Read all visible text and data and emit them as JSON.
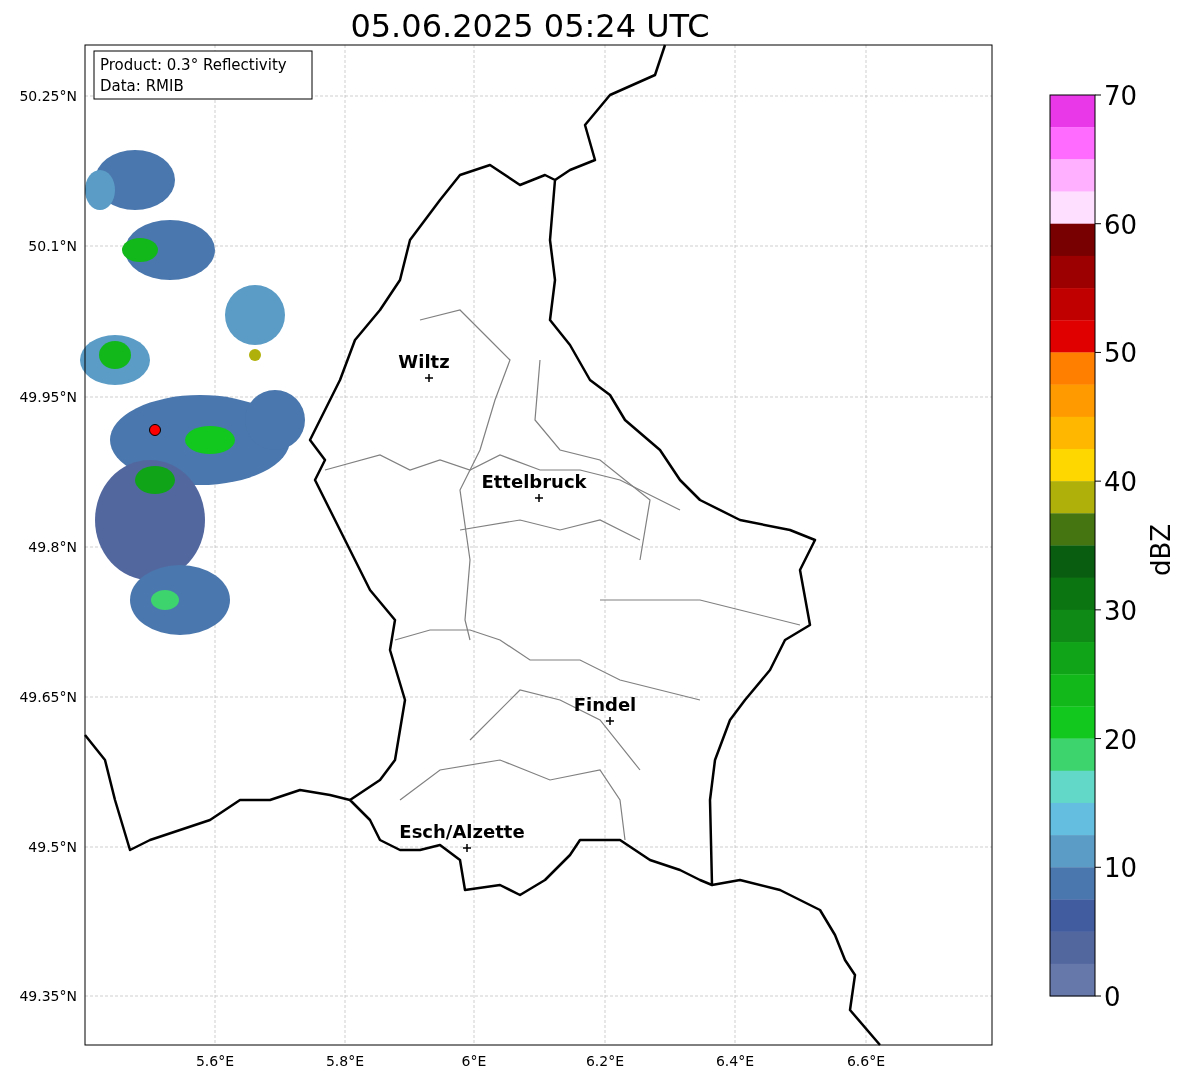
{
  "title": "05.06.2025 05:24 UTC",
  "info_box": [
    "Product: 0.3° Reflectivity",
    "Data: RMIB"
  ],
  "map": {
    "cities": [
      {
        "name": "Wiltz"
      },
      {
        "name": "Ettelbruck"
      },
      {
        "name": "Findel"
      },
      {
        "name": "Esch/Alzette"
      }
    ],
    "x_ticks": [
      "5.6°E",
      "5.8°E",
      "6°E",
      "6.2°E",
      "6.4°E",
      "6.6°E"
    ],
    "y_ticks": [
      "50.25°N",
      "50.1°N",
      "49.95°N",
      "49.8°N",
      "49.65°N",
      "49.5°N",
      "49.35°N"
    ]
  },
  "colorbar": {
    "label": "dBZ",
    "ticks": [
      "70",
      "60",
      "50",
      "40",
      "30",
      "20",
      "10",
      "0"
    ],
    "bins": [
      {
        "color": "#e838e8"
      },
      {
        "color": "#ff6aff"
      },
      {
        "color": "#ffb0ff"
      },
      {
        "color": "#ffdfff"
      },
      {
        "color": "#780000"
      },
      {
        "color": "#9c0000"
      },
      {
        "color": "#c00000"
      },
      {
        "color": "#e00000"
      },
      {
        "color": "#ff7f00"
      },
      {
        "color": "#ff9a00"
      },
      {
        "color": "#ffb700"
      },
      {
        "color": "#ffd700"
      },
      {
        "color": "#b0b00a"
      },
      {
        "color": "#447510"
      },
      {
        "color": "#095d10"
      },
      {
        "color": "#0b7512"
      },
      {
        "color": "#0f8a16"
      },
      {
        "color": "#10a418"
      },
      {
        "color": "#12b81a"
      },
      {
        "color": "#12c81e"
      },
      {
        "color": "#3dd46e"
      },
      {
        "color": "#62d8c8"
      },
      {
        "color": "#64bee0"
      },
      {
        "color": "#5a9cc6"
      },
      {
        "color": "#4a77ad"
      },
      {
        "color": "#425ca0"
      },
      {
        "color": "#53679f"
      },
      {
        "color": "#6677aa"
      }
    ]
  }
}
